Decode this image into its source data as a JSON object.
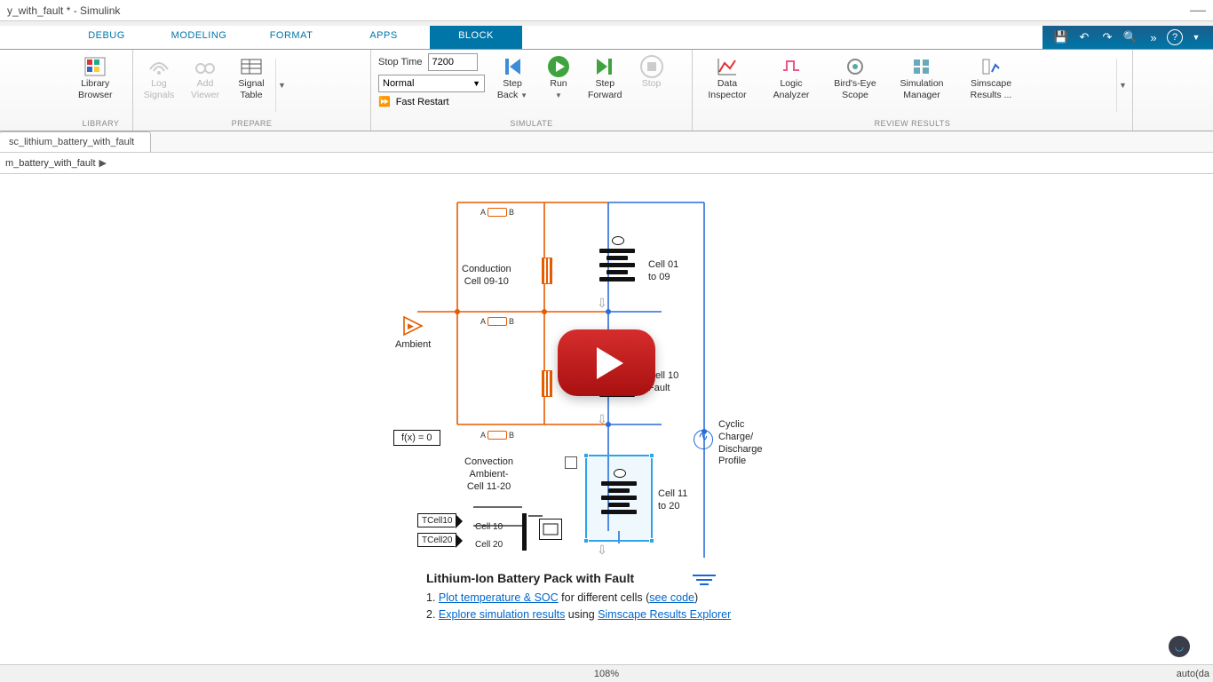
{
  "titlebar": {
    "title": "y_with_fault * - Simulink"
  },
  "tabs": {
    "items": [
      {
        "label": "DEBUG"
      },
      {
        "label": "MODELING"
      },
      {
        "label": "FORMAT"
      },
      {
        "label": "APPS"
      },
      {
        "label": "BLOCK"
      }
    ],
    "active_index": 4
  },
  "qab": {
    "save": "💾",
    "undo": "↶",
    "redo": "↷",
    "search": "🔍",
    "more": "»",
    "help": "?"
  },
  "toolstrip": {
    "library": {
      "label1": "Library",
      "label2": "Browser",
      "group": "LIBRARY"
    },
    "prepare": {
      "log1": "Log",
      "log2": "Signals",
      "add1": "Add",
      "add2": "Viewer",
      "sig1": "Signal",
      "sig2": "Table",
      "group": "PREPARE"
    },
    "simulate": {
      "stop_time_label": "Stop Time",
      "stop_time_value": "7200",
      "mode_value": "Normal",
      "fast_restart": "Fast Restart",
      "step_back1": "Step",
      "step_back2": "Back",
      "run": "Run",
      "step_fwd1": "Step",
      "step_fwd2": "Forward",
      "stop": "Stop",
      "group": "SIMULATE"
    },
    "review": {
      "di1": "Data",
      "di2": "Inspector",
      "la1": "Logic",
      "la2": "Analyzer",
      "be1": "Bird's-Eye",
      "be2": "Scope",
      "sm1": "Simulation",
      "sm2": "Manager",
      "sr1": "Simscape",
      "sr2": "Results ...",
      "group": "REVIEW RESULTS"
    }
  },
  "window_tab": "sc_lithium_battery_with_fault",
  "breadcrumb": "m_battery_with_fault",
  "diagram": {
    "conduction": "Conduction\nCell 09-10",
    "ambient": "Ambient",
    "fx": "f(x) = 0",
    "convection": "Convection\nAmbient-\nCell 11-20",
    "cell01": "Cell 01\nto 09",
    "cell10f": "Cell 10\nFault",
    "cell11": "Cell 11\nto 20",
    "cyclic": "Cyclic\nCharge/\nDischarge\nProfile",
    "tcell10": "TCell10",
    "tcell20": "TCell20",
    "mux1": "Cell 10",
    "mux2": "Cell 20",
    "ab_a": "A",
    "ab_b": "B"
  },
  "footer": {
    "title": "Lithium-Ion Battery Pack with Fault",
    "line1_a": "1. ",
    "link1": "Plot temperature & SOC",
    "line1_b": " for different cells (",
    "link1b": "see code",
    "line1_c": ")",
    "line2_a": "2. ",
    "link2": "Explore simulation results",
    "line2_b": " using ",
    "link2b": "Simscape Results Explorer"
  },
  "statusbar": {
    "zoom": "108%",
    "solver": "auto(da"
  },
  "colors": {
    "accent": "#0076a8",
    "orange": "#e55b00",
    "blue": "#1a65d9",
    "sel": "#2ea3e8"
  }
}
